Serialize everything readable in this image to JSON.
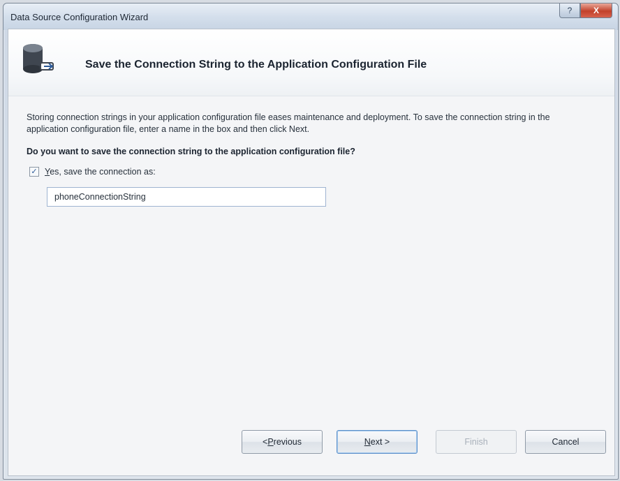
{
  "window": {
    "title": "Data Source Configuration Wizard",
    "help_glyph": "?",
    "close_glyph": "X"
  },
  "header": {
    "title": "Save the Connection String to the Application Configuration File",
    "icon": "database-icon"
  },
  "description": "Storing connection strings in your application configuration file eases maintenance and deployment. To save the connection string in the application configuration file, enter a name in the box and then click Next.",
  "question": "Do you want to save the connection string to the application configuration file?",
  "save_option": {
    "checked": true,
    "label_mnemonic": "Y",
    "label_rest": "es, save the connection as:"
  },
  "connection_name": {
    "value": "phoneConnectionString"
  },
  "buttons": {
    "previous_prefix": "< ",
    "previous_mnemonic": "P",
    "previous_rest": "revious",
    "next_mnemonic": "N",
    "next_rest": "ext >",
    "finish": "Finish",
    "cancel": "Cancel"
  },
  "colors": {
    "accent": "#5d90c9",
    "close_button": "#c2412a"
  }
}
